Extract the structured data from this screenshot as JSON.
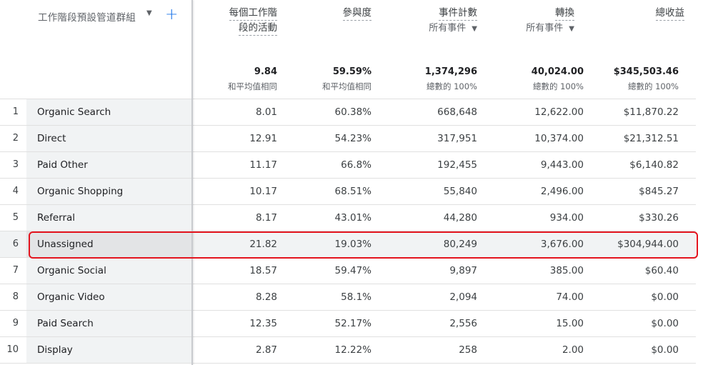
{
  "dimension_header": {
    "title": "工作階段預設管道群組",
    "caret": "▼",
    "add": "+"
  },
  "columns": [
    {
      "label_line1": "每個工作階",
      "label_line2": "段的活動",
      "sub": "",
      "total": "9.84",
      "total_sub": "和平均值相同"
    },
    {
      "label_line1": "參與度",
      "label_line2": "",
      "sub": "",
      "total": "59.59%",
      "total_sub": "和平均值相同"
    },
    {
      "label_line1": "事件計數",
      "label_line2": "",
      "sub": "所有事件",
      "total": "1,374,296",
      "total_sub": "總數的 100%"
    },
    {
      "label_line1": "轉換",
      "label_line2": "",
      "sub": "所有事件",
      "total": "40,024.00",
      "total_sub": "總數的 100%"
    },
    {
      "label_line1": "總收益",
      "label_line2": "",
      "sub": "",
      "total": "$345,503.46",
      "total_sub": "總數的 100%"
    }
  ],
  "rows": [
    {
      "idx": "1",
      "name": "Organic Search",
      "v": [
        "8.01",
        "60.38%",
        "668,648",
        "12,622.00",
        "$11,870.22"
      ]
    },
    {
      "idx": "2",
      "name": "Direct",
      "v": [
        "12.91",
        "54.23%",
        "317,951",
        "10,374.00",
        "$21,312.51"
      ]
    },
    {
      "idx": "3",
      "name": "Paid Other",
      "v": [
        "11.17",
        "66.8%",
        "192,455",
        "9,443.00",
        "$6,140.82"
      ]
    },
    {
      "idx": "4",
      "name": "Organic Shopping",
      "v": [
        "10.17",
        "68.51%",
        "55,840",
        "2,496.00",
        "$845.27"
      ]
    },
    {
      "idx": "5",
      "name": "Referral",
      "v": [
        "8.17",
        "43.01%",
        "44,280",
        "934.00",
        "$330.26"
      ]
    },
    {
      "idx": "6",
      "name": "Unassigned",
      "v": [
        "21.82",
        "19.03%",
        "80,249",
        "3,676.00",
        "$304,944.00"
      ]
    },
    {
      "idx": "7",
      "name": "Organic Social",
      "v": [
        "18.57",
        "59.47%",
        "9,897",
        "385.00",
        "$60.40"
      ]
    },
    {
      "idx": "8",
      "name": "Organic Video",
      "v": [
        "8.28",
        "58.1%",
        "2,094",
        "74.00",
        "$0.00"
      ]
    },
    {
      "idx": "9",
      "name": "Paid Search",
      "v": [
        "12.35",
        "52.17%",
        "2,556",
        "15.00",
        "$0.00"
      ]
    },
    {
      "idx": "10",
      "name": "Display",
      "v": [
        "2.87",
        "12.22%",
        "258",
        "2.00",
        "$0.00"
      ]
    }
  ],
  "highlighted_row": "Unassigned",
  "colors": {
    "accent": "#1a73e8",
    "highlight": "#e3141e",
    "dim_bg": "#f1f3f4"
  }
}
